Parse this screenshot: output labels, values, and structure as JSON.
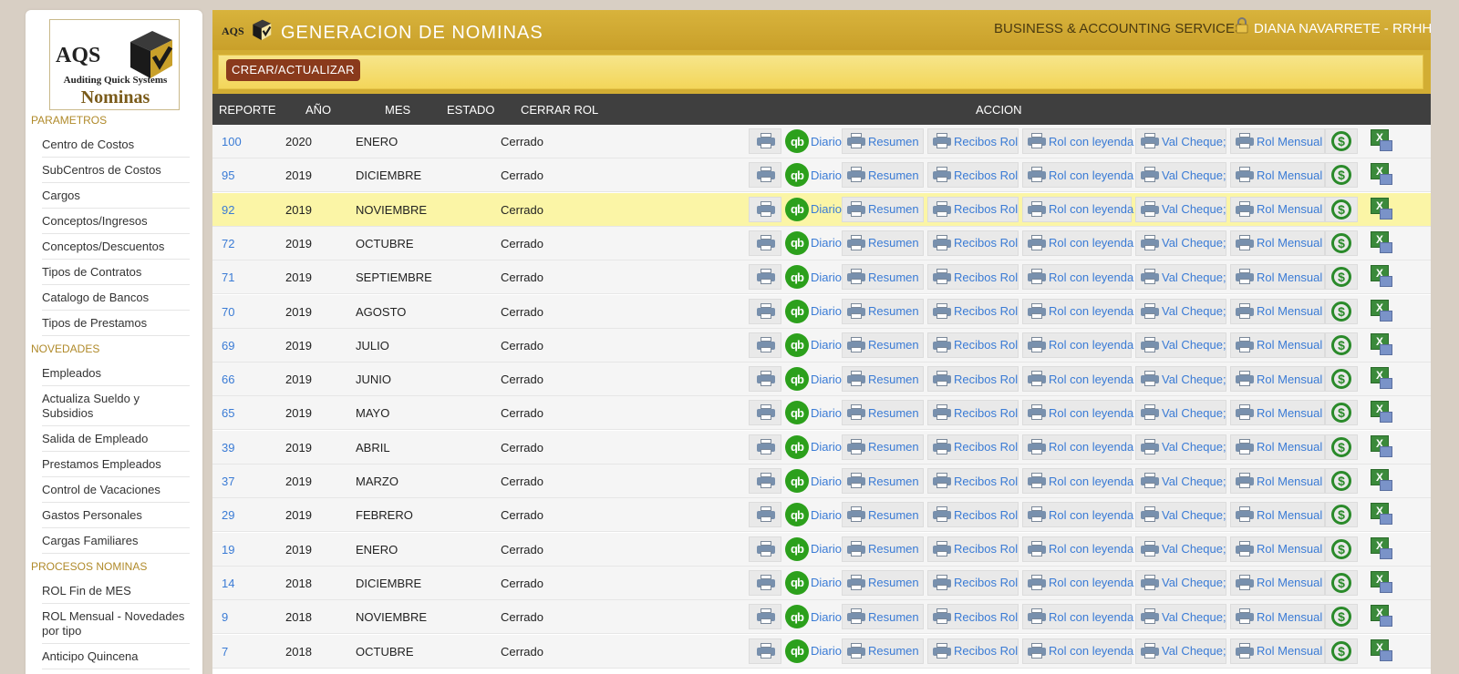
{
  "app": {
    "logo_aqs": "AQS",
    "logo_full": "Auditing Quick Systems",
    "logo_module": "Nominas",
    "title": "GENERACION DE NOMINAS",
    "company": "BUSINESS & ACCOUNTING SERVICES",
    "user": "DIANA NAVARRETE - RRHH"
  },
  "sidebar": {
    "sections": [
      {
        "title": "PARAMETROS",
        "items": [
          "Centro de Costos",
          "SubCentros de Costos",
          "Cargos",
          "Conceptos/Ingresos",
          "Conceptos/Descuentos",
          "Tipos de Contratos",
          "Catalogo de Bancos",
          "Tipos de Prestamos"
        ]
      },
      {
        "title": "NOVEDADES",
        "items": [
          "Empleados",
          "Actualiza Sueldo y Subsidios",
          "Salida de Empleado",
          "Prestamos Empleados",
          "Control de Vacaciones",
          "Gastos Personales",
          "Cargas Familiares"
        ]
      },
      {
        "title": "PROCESOS NOMINAS",
        "items": [
          "ROL Fin de MES",
          "ROL Mensual - Novedades por tipo",
          "Anticipo Quincena"
        ]
      }
    ]
  },
  "toolbar": {
    "create_label": "CREAR/ACTUALIZAR"
  },
  "table": {
    "headers": {
      "reporte": "REPORTE",
      "ano": "AÑO",
      "mes": "MES",
      "estado": "ESTADO",
      "cerrar": "CERRAR ROL",
      "accion": "ACCION"
    },
    "action_labels": {
      "diario": "Diario",
      "resumen": "Resumen",
      "recibos": "Recibos Rol",
      "leyenda": "Rol con leyenda",
      "cheque": "Val Cheque;",
      "mensual": "Rol Mensual"
    },
    "rows": [
      {
        "reporte": "100",
        "ano": "2020",
        "mes": "ENERO",
        "estado": "Cerrado"
      },
      {
        "reporte": "95",
        "ano": "2019",
        "mes": "DICIEMBRE",
        "estado": "Cerrado"
      },
      {
        "reporte": "92",
        "ano": "2019",
        "mes": "NOVIEMBRE",
        "estado": "Cerrado",
        "highlight": true
      },
      {
        "reporte": "72",
        "ano": "2019",
        "mes": "OCTUBRE",
        "estado": "Cerrado"
      },
      {
        "reporte": "71",
        "ano": "2019",
        "mes": "SEPTIEMBRE",
        "estado": "Cerrado"
      },
      {
        "reporte": "70",
        "ano": "2019",
        "mes": "AGOSTO",
        "estado": "Cerrado"
      },
      {
        "reporte": "69",
        "ano": "2019",
        "mes": "JULIO",
        "estado": "Cerrado"
      },
      {
        "reporte": "66",
        "ano": "2019",
        "mes": "JUNIO",
        "estado": "Cerrado"
      },
      {
        "reporte": "65",
        "ano": "2019",
        "mes": "MAYO",
        "estado": "Cerrado"
      },
      {
        "reporte": "39",
        "ano": "2019",
        "mes": "ABRIL",
        "estado": "Cerrado"
      },
      {
        "reporte": "37",
        "ano": "2019",
        "mes": "MARZO",
        "estado": "Cerrado"
      },
      {
        "reporte": "29",
        "ano": "2019",
        "mes": "FEBRERO",
        "estado": "Cerrado"
      },
      {
        "reporte": "19",
        "ano": "2019",
        "mes": "ENERO",
        "estado": "Cerrado"
      },
      {
        "reporte": "14",
        "ano": "2018",
        "mes": "DICIEMBRE",
        "estado": "Cerrado"
      },
      {
        "reporte": "9",
        "ano": "2018",
        "mes": "NOVIEMBRE",
        "estado": "Cerrado"
      },
      {
        "reporte": "7",
        "ano": "2018",
        "mes": "OCTUBRE",
        "estado": "Cerrado"
      }
    ]
  },
  "icons": {
    "printer": "printer-icon",
    "quickbooks": "quickbooks-icon",
    "sync": "sync-icon",
    "excel": "excel-export-icon",
    "lock": "lock-icon"
  },
  "colors": {
    "gold": "#c9a02a",
    "header_dark": "#3f3f3f",
    "link": "#3a7bd5",
    "highlight": "#fbf5a6",
    "button": "#8a3a1c"
  }
}
